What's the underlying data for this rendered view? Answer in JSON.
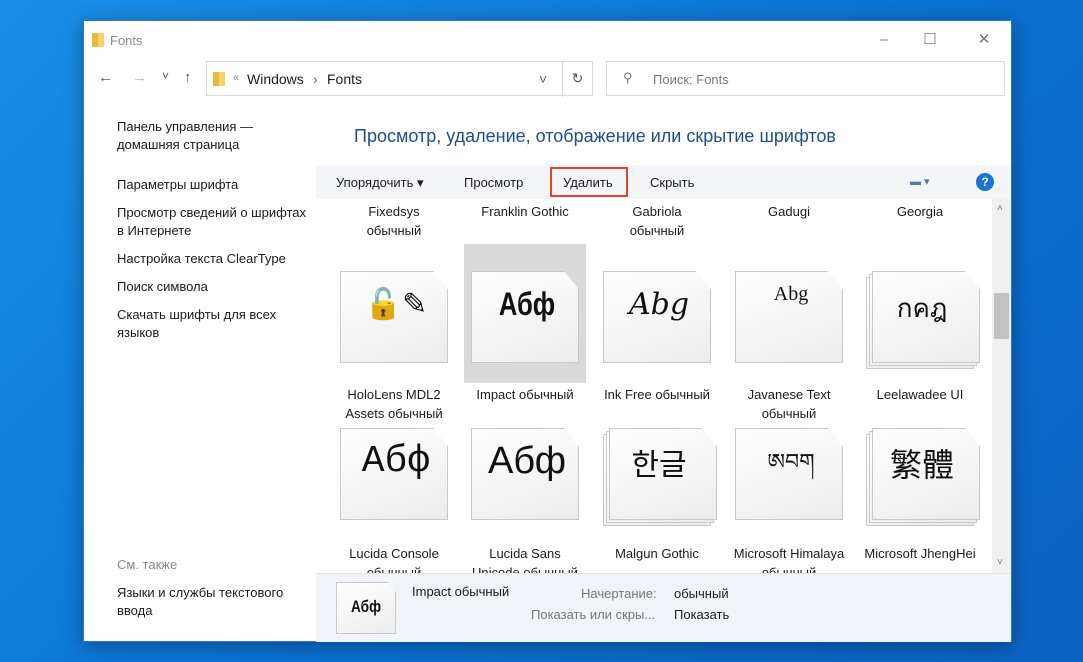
{
  "window": {
    "title": "Fonts",
    "minimize": "–",
    "maximize": "☐",
    "close": "✕"
  },
  "nav": {
    "back": "←",
    "forward": "→",
    "recent": "˅",
    "up": "↑",
    "breadcrumb": [
      "«",
      "Windows",
      "›",
      "Fonts"
    ],
    "dropdown": "˅",
    "refresh": "↻",
    "search_placeholder": "Поиск: Fonts",
    "search_icon": "⚲"
  },
  "sidebar": {
    "items": [
      "Панель управления — домашняя страница",
      "Параметры шрифта",
      "Просмотр сведений о шрифтах в Интернете",
      "Настройка текста ClearType",
      "Поиск символа",
      "Скачать шрифты для всех языков"
    ],
    "see_also": "См. также",
    "see_also_items": [
      "Языки и службы текстового ввода"
    ]
  },
  "heading": "Просмотр, удаление, отображение или скрытие шрифтов",
  "toolbar": {
    "organize": "Упорядочить ▾",
    "preview": "Просмотр",
    "delete": "Удалить",
    "hide": "Скрыть",
    "view_icon": "▬ ▾",
    "help": "?"
  },
  "top_row": [
    [
      "Fixedsys",
      "обычный"
    ],
    [
      "Franklin Gothic",
      ""
    ],
    [
      "Gabriola",
      "обычный"
    ],
    [
      "Gadugi",
      ""
    ],
    [
      "Georgia",
      ""
    ]
  ],
  "fonts": [
    {
      "name": "HoloLens MDL2 Assets обычный",
      "sample": "🔓✎",
      "stack": false
    },
    {
      "name": "Impact обычный",
      "sample": "Абф",
      "stack": false,
      "selected": true
    },
    {
      "name": "Ink Free обычный",
      "sample": "Abg",
      "stack": false
    },
    {
      "name": "Javanese Text обычный",
      "sample": "Abg",
      "stack": false
    },
    {
      "name": "Leelawadee UI",
      "sample": "กคฎ",
      "stack": true
    },
    {
      "name": "Lucida Console обычный",
      "sample": "Абф",
      "stack": false
    },
    {
      "name": "Lucida Sans Unicode обычный",
      "sample": "Абф",
      "stack": false
    },
    {
      "name": "Malgun Gothic",
      "sample": "한글",
      "stack": true
    },
    {
      "name": "Microsoft Himalaya обычный",
      "sample": "ཨབག",
      "stack": false
    },
    {
      "name": "Microsoft JhengHei",
      "sample": "繁體",
      "stack": true
    }
  ],
  "details": {
    "name": "Impact обычный",
    "sample": "Абф",
    "style_label": "Начертание:",
    "style_value": "обычный",
    "show_label": "Показать или скры...",
    "show_value": "Показать"
  }
}
